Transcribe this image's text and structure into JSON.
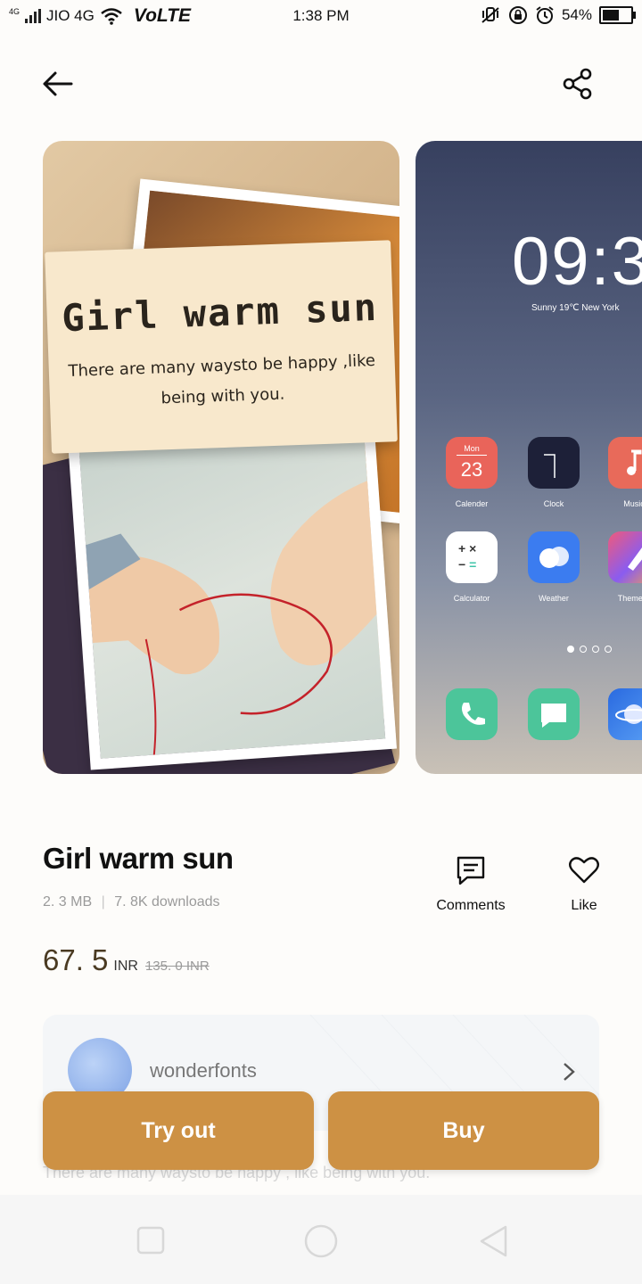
{
  "status_bar": {
    "network_small": "4G",
    "carrier": "JIO 4G",
    "volte": "VoLTE",
    "time": "1:38 PM",
    "battery": "54%"
  },
  "preview": {
    "card_title": "Girl warm sun",
    "card_subtitle_line1": "There are many waysto be happy ,like",
    "card_subtitle_line2": "being with you.",
    "lock_time": "09:3",
    "lock_weather": "Sunny 19℃ New York",
    "calendar_month": "Mon",
    "calendar_day": "23",
    "apps": [
      {
        "label": "Calender"
      },
      {
        "label": "Clock"
      },
      {
        "label": "Music"
      },
      {
        "label": "Calculator"
      },
      {
        "label": "Weather"
      },
      {
        "label": "Theme S"
      }
    ]
  },
  "theme": {
    "title": "Girl warm sun",
    "size": "2. 3 MB",
    "separator": "|",
    "downloads": "7. 8K downloads",
    "price": "67. 5",
    "currency": "INR",
    "original_price": "135. 0 INR",
    "comments_label": "Comments",
    "like_label": "Like",
    "author": "wonderfonts",
    "description": "There are many waysto be happy , like being with you."
  },
  "buttons": {
    "try_out": "Try out",
    "buy": "Buy"
  },
  "colors": {
    "accent": "#cd9144",
    "price_text": "#4a3a22"
  }
}
